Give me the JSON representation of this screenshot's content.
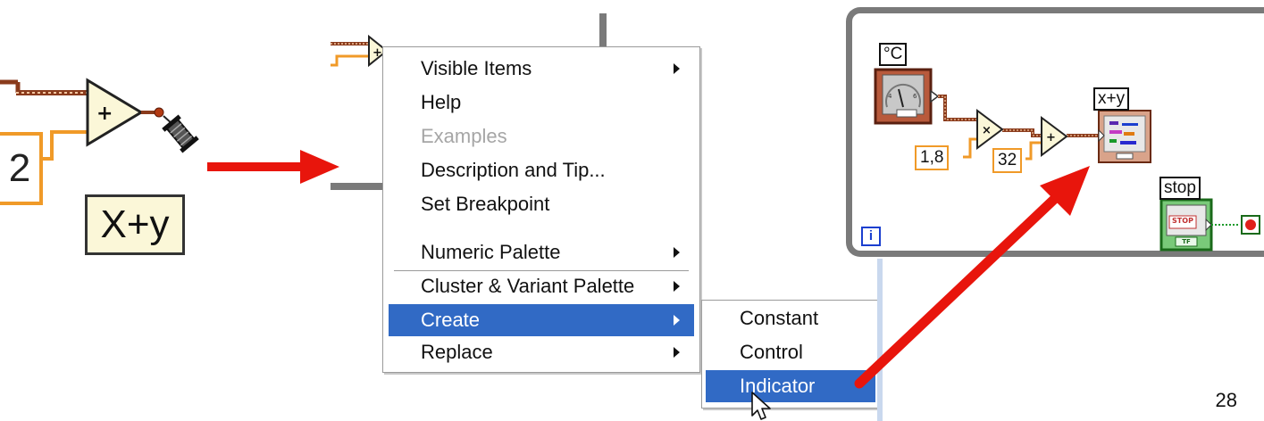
{
  "left_snippet": {
    "constant_value": "2",
    "indicator_label": "X+y"
  },
  "context_menu": {
    "items": [
      {
        "label": "Visible Items",
        "submenu": true,
        "enabled": true
      },
      {
        "label": "Help",
        "submenu": false,
        "enabled": true
      },
      {
        "label": "Examples",
        "submenu": false,
        "enabled": false
      },
      {
        "label": "Description and Tip...",
        "submenu": false,
        "enabled": true
      },
      {
        "label": "Set Breakpoint",
        "submenu": false,
        "enabled": true
      },
      {
        "label": "Numeric Palette",
        "submenu": true,
        "enabled": true
      },
      {
        "label": "Cluster & Variant Palette",
        "submenu": true,
        "enabled": true
      },
      {
        "label": "Create",
        "submenu": true,
        "enabled": true,
        "selected": true
      },
      {
        "label": "Replace",
        "submenu": true,
        "enabled": true
      }
    ]
  },
  "create_submenu": {
    "items": [
      {
        "label": "Constant"
      },
      {
        "label": "Control"
      },
      {
        "label": "Indicator",
        "selected": true
      }
    ]
  },
  "block_diagram": {
    "celsius_label": "°C",
    "multiplier_constant": "1,8",
    "offset_constant": "32",
    "result_label": "x+y",
    "stop_label": "stop",
    "stop_button_text": "STOP",
    "stop_tf_text": "TF",
    "iteration_terminal": "i"
  },
  "page_number": "28",
  "colors": {
    "menu_highlight": "#316ac5",
    "wire_orange": "#f09a28",
    "wire_brown": "#8a3b1c",
    "arrow_red": "#e8150c",
    "frame_gray": "#7a7a7a",
    "node_fill": "#fbf7d8"
  }
}
